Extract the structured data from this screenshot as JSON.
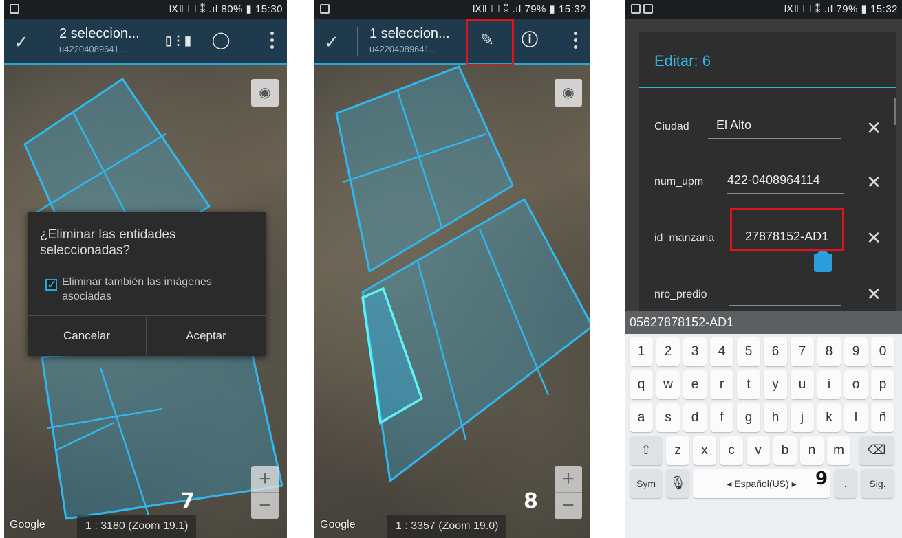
{
  "status": {
    "s1": "ⅨⅡ ☐ ⁑ .ıl 80% ▮ 15:30",
    "s2": "ⅨⅡ ☐ ⁑ .ıl 79% ▮ 15:32",
    "s3": "ⅨⅡ ☐ ⁑ .ıl 79% ▮ 15:32"
  },
  "panel1": {
    "title": "2 seleccion...",
    "subtitle": "u42204089641...",
    "dialog_title": "¿Eliminar las entidades seleccionadas?",
    "checkbox_label": "Eliminar también las imágenes asociadas",
    "cancel": "Cancelar",
    "accept": "Aceptar",
    "google": "Google",
    "scale": "1 : 3180 (Zoom 19.1)",
    "step": "7"
  },
  "panel2": {
    "title": "1 seleccion...",
    "subtitle": "u42204089641...",
    "google": "Google",
    "scale": "1 : 3357 (Zoom 19.0)",
    "step": "8"
  },
  "panel3": {
    "edit_title": "Editar: 6",
    "fields": [
      {
        "label": "Ciudad",
        "value": "El Alto"
      },
      {
        "label": "num_upm",
        "value": "422-0408964114"
      },
      {
        "label": "id_manzana",
        "value": "27878152-AD1"
      },
      {
        "label": "nro_predio",
        "value": ""
      }
    ],
    "suggestion": "05627878152-AD1",
    "step": "9",
    "keyboard": {
      "row_numbers": [
        "1",
        "2",
        "3",
        "4",
        "5",
        "6",
        "7",
        "8",
        "9",
        "0"
      ],
      "row_q": [
        "q",
        "w",
        "e",
        "r",
        "t",
        "y",
        "u",
        "i",
        "o",
        "p"
      ],
      "row_a": [
        "a",
        "s",
        "d",
        "f",
        "g",
        "h",
        "j",
        "k",
        "l",
        "ñ"
      ],
      "row_z": [
        "z",
        "x",
        "c",
        "v",
        "b",
        "n",
        "m"
      ],
      "sym": "Sym",
      "space": "◂ Español(US) ▸",
      "period": ".",
      "next": "Sig."
    }
  },
  "colors": {
    "accent": "#26a6d9",
    "highlight_box": "#e0141e",
    "parcel_stroke": "#2fb7ee"
  }
}
